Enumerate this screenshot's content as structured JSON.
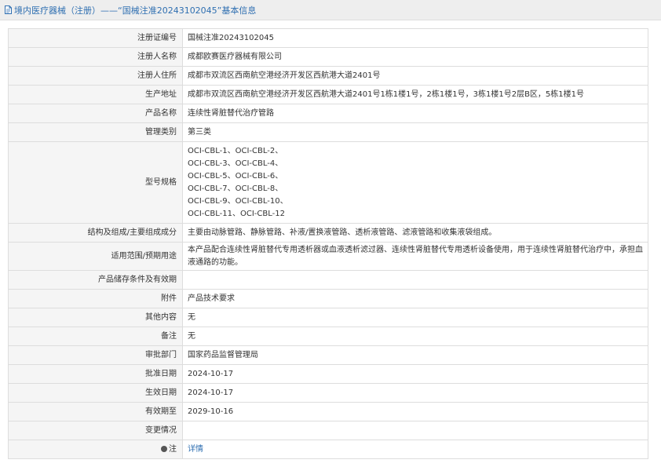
{
  "header": {
    "title": "境内医疗器械（注册）——“国械注准20243102045”基本信息"
  },
  "rows": [
    {
      "label": "注册证编号",
      "value": "国械注准20243102045"
    },
    {
      "label": "注册人名称",
      "value": "成都欧赛医疗器械有限公司"
    },
    {
      "label": "注册人住所",
      "value": "成都市双流区西南航空港经济开发区西航港大道2401号"
    },
    {
      "label": "生产地址",
      "value": "成都市双流区西南航空港经济开发区西航港大道2401号1栋1楼1号，2栋1楼1号，3栋1楼1号2层B区，5栋1楼1号"
    },
    {
      "label": "产品名称",
      "value": "连续性肾脏替代治疗管路"
    },
    {
      "label": "管理类别",
      "value": "第三类"
    },
    {
      "label": "型号规格",
      "values": [
        "OCI-CBL-1、OCI-CBL-2、",
        "OCI-CBL-3、OCI-CBL-4、",
        "OCI-CBL-5、OCI-CBL-6、",
        "OCI-CBL-7、OCI-CBL-8、",
        "OCI-CBL-9、OCI-CBL-10、",
        "OCI-CBL-11、OCI-CBL-12"
      ]
    },
    {
      "label": "结构及组成/主要组成成分",
      "value": "主要由动脉管路、静脉管路、补液/置换液管路、透析液管路、滤液管路和收集液袋组成。"
    },
    {
      "label": "适用范围/预期用途",
      "value": "本产品配合连续性肾脏替代专用透析器或血液透析滤过器、连续性肾脏替代专用透析设备使用，用于连续性肾脏替代治疗中，承担血液通路的功能。"
    },
    {
      "label": "产品储存条件及有效期",
      "value": ""
    },
    {
      "label": "附件",
      "value": "产品技术要求"
    },
    {
      "label": "其他内容",
      "value": "无"
    },
    {
      "label": "备注",
      "value": "无"
    },
    {
      "label": "审批部门",
      "value": "国家药品监督管理局"
    },
    {
      "label": "批准日期",
      "value": "2024-10-17"
    },
    {
      "label": "生效日期",
      "value": "2024-10-17"
    },
    {
      "label": "有效期至",
      "value": "2029-10-16"
    },
    {
      "label": "变更情况",
      "value": ""
    },
    {
      "label": "注",
      "value": "详情"
    }
  ]
}
